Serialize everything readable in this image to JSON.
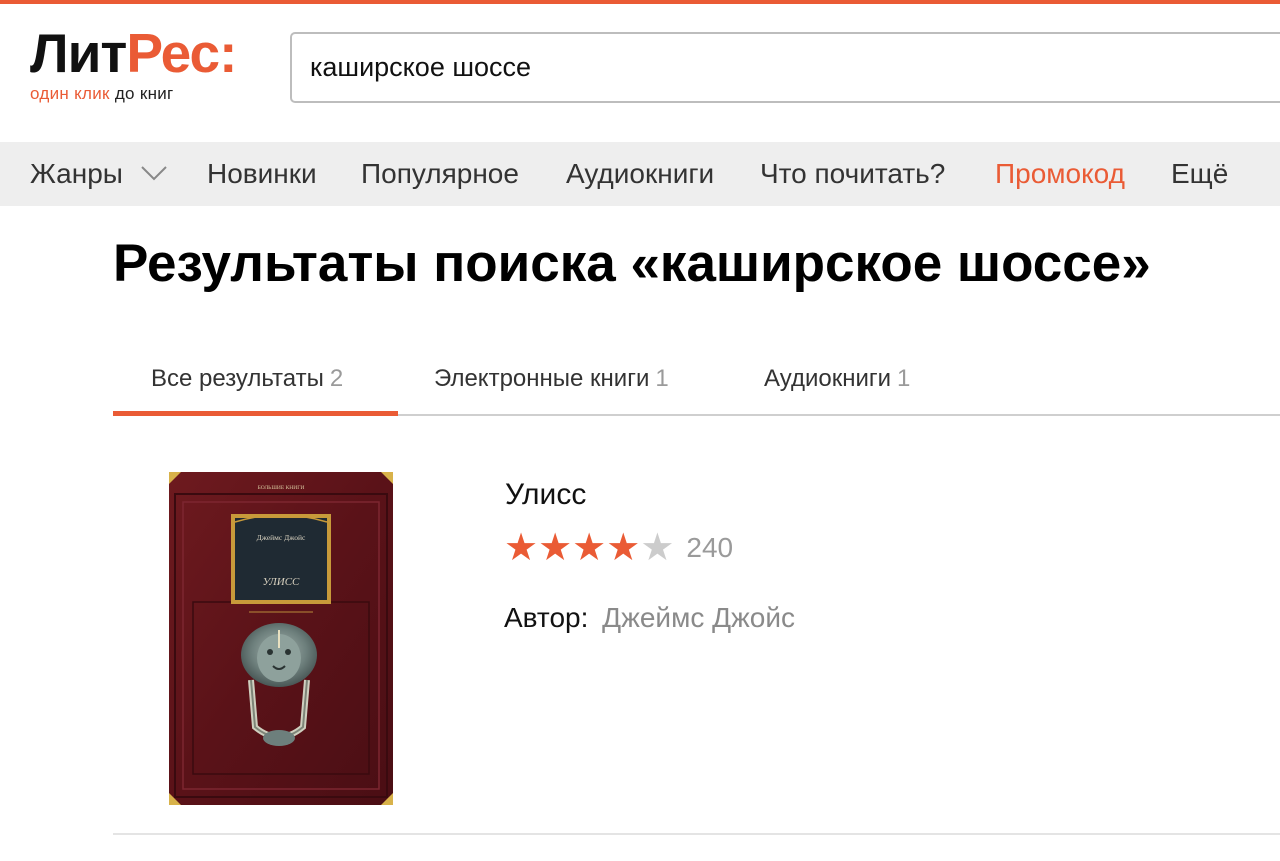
{
  "brand": {
    "logo_left": "Лит",
    "logo_right": "Рес:",
    "tagline_orange": "один клик",
    "tagline_dark": "до книг",
    "accent_color": "#ea5b35"
  },
  "search": {
    "value": "каширское шоссе"
  },
  "nav": {
    "items": [
      {
        "label": "Жанры",
        "icon": "chevron-down-icon"
      },
      {
        "label": "Новинки"
      },
      {
        "label": "Популярное"
      },
      {
        "label": "Аудиокниги"
      },
      {
        "label": "Что почитать?"
      },
      {
        "label": "Промокод"
      },
      {
        "label": "Ещё"
      }
    ]
  },
  "page": {
    "title": "Результаты поиска «каширское шоссе»"
  },
  "tabs": [
    {
      "label": "Все результаты",
      "count": "2",
      "active": true
    },
    {
      "label": "Электронные книги",
      "count": "1",
      "active": false
    },
    {
      "label": "Аудиокниги",
      "count": "1",
      "active": false
    }
  ],
  "results": [
    {
      "title": "Улисс",
      "rating_stars": 4,
      "rating_max": 5,
      "rating_count": "240",
      "author_label": "Автор:",
      "author": "Джеймс Джойс",
      "cover": {
        "series": "БОЛЬШИЕ КНИГИ",
        "author": "Джеймс Джойс",
        "title": "УЛИСС"
      }
    }
  ]
}
